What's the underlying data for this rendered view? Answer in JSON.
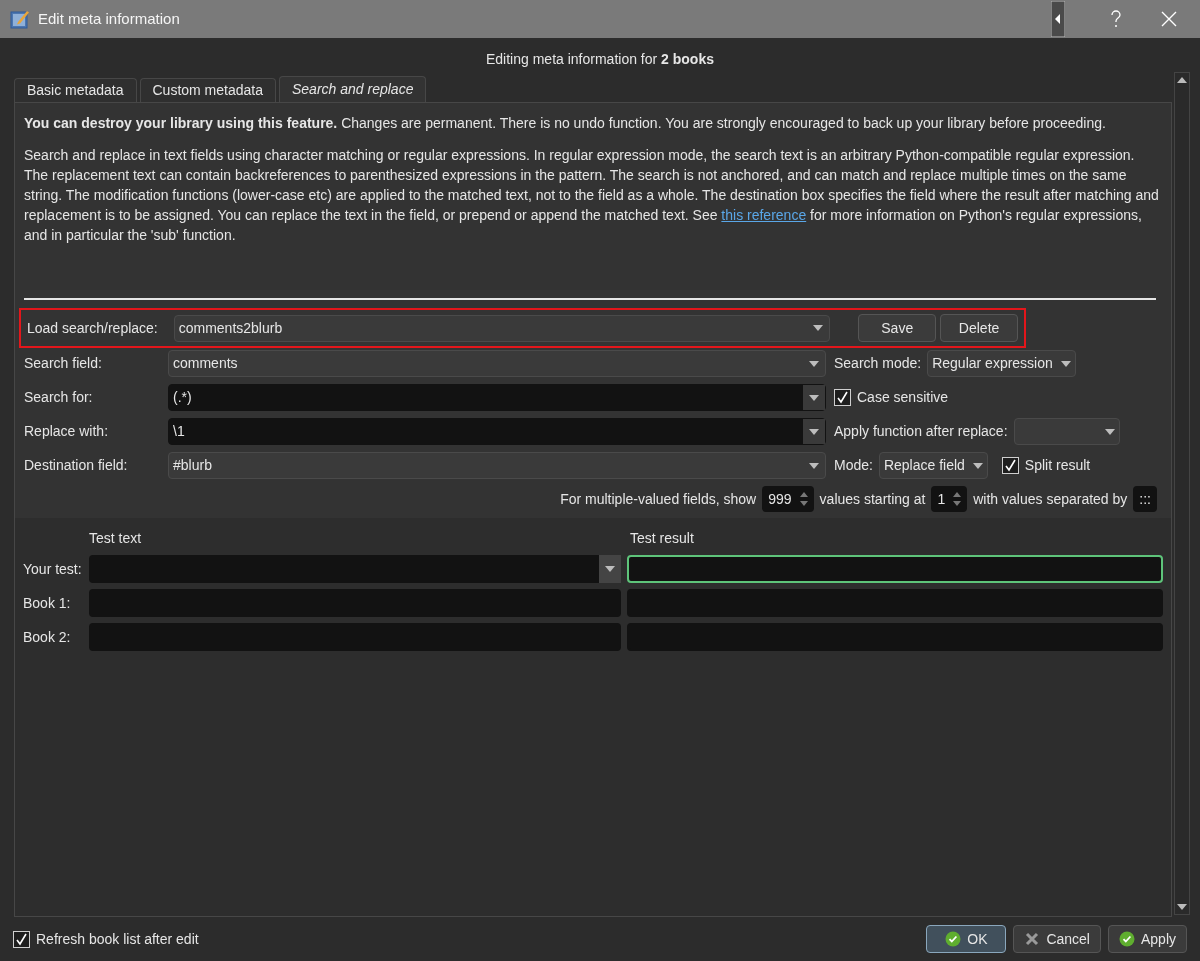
{
  "window": {
    "title": "Edit meta information"
  },
  "header": "Editing meta information for **2 books**",
  "tabs": [
    {
      "label": "Basic metadata",
      "selected": false
    },
    {
      "label": "Custom metadata",
      "selected": false
    },
    {
      "label": "Search and replace",
      "selected": true
    }
  ],
  "warning": {
    "bold": "You can destroy your library using this feature.",
    "rest": " Changes are permanent. There is no undo function. You are strongly encouraged to back up your library before proceeding."
  },
  "description": {
    "before": "Search and replace in text fields using character matching or regular expressions. In regular expression mode, the search text is an arbitrary Python-compatible regular expression. The replacement text can contain backreferences to parenthesized expressions in the pattern. The search is not anchored, and can match and replace multiple times on the same string. The modification functions (lower-case etc) are applied to the matched text, not to the field as a whole. The destination box specifies the field where the result after matching and replacement is to be assigned. You can replace the text in the field, or prepend or append the matched text. See ",
    "link": "this reference",
    "after": " for more information on Python's regular expressions, and in particular the 'sub' function."
  },
  "load": {
    "label": "Load search/replace:",
    "value": "comments2blurb",
    "highlighted": true,
    "buttons": [
      "Save",
      "Delete"
    ]
  },
  "rows": [
    {
      "label": "Search field:",
      "kind": "combo",
      "value": "comments",
      "side": {
        "kind": "select",
        "label": "Search mode:",
        "value": "Regular expression"
      }
    },
    {
      "label": "Search for:",
      "kind": "editable",
      "value": "(.*)",
      "side": {
        "kind": "check",
        "label": "Case sensitive",
        "checked": true
      }
    },
    {
      "label": "Replace with:",
      "kind": "editable",
      "value": "\\1",
      "side": {
        "kind": "select",
        "label": "Apply function after replace:"
      }
    },
    {
      "label": "Destination field:",
      "kind": "combo",
      "value": "#blurb",
      "side": {
        "kind": "select",
        "label": "Mode:",
        "value": "Replace field",
        "check": {
          "label": "Split result",
          "checked": true
        }
      }
    }
  ],
  "multi": {
    "show_label": "For multiple-valued fields, show",
    "show_value": "999",
    "start_label": "values starting at",
    "start_value": "1",
    "sep_label": "with values separated by",
    "sep_value": ":::"
  },
  "test": {
    "columns": [
      "Test text",
      "Test result"
    ],
    "rows": [
      {
        "label": "Your test:",
        "kind": "combo",
        "focused": true
      },
      {
        "label": "Book 1:",
        "kind": "plain",
        "focused": false
      },
      {
        "label": "Book 2:",
        "kind": "plain",
        "focused": false
      }
    ]
  },
  "footer": {
    "refresh": {
      "label": "Refresh book list after edit",
      "checked": true
    },
    "buttons": [
      {
        "label": "OK",
        "kind": "accept",
        "default": true
      },
      {
        "label": "Cancel",
        "kind": "reject",
        "default": false
      },
      {
        "label": "Apply",
        "kind": "accept",
        "default": false
      }
    ]
  }
}
